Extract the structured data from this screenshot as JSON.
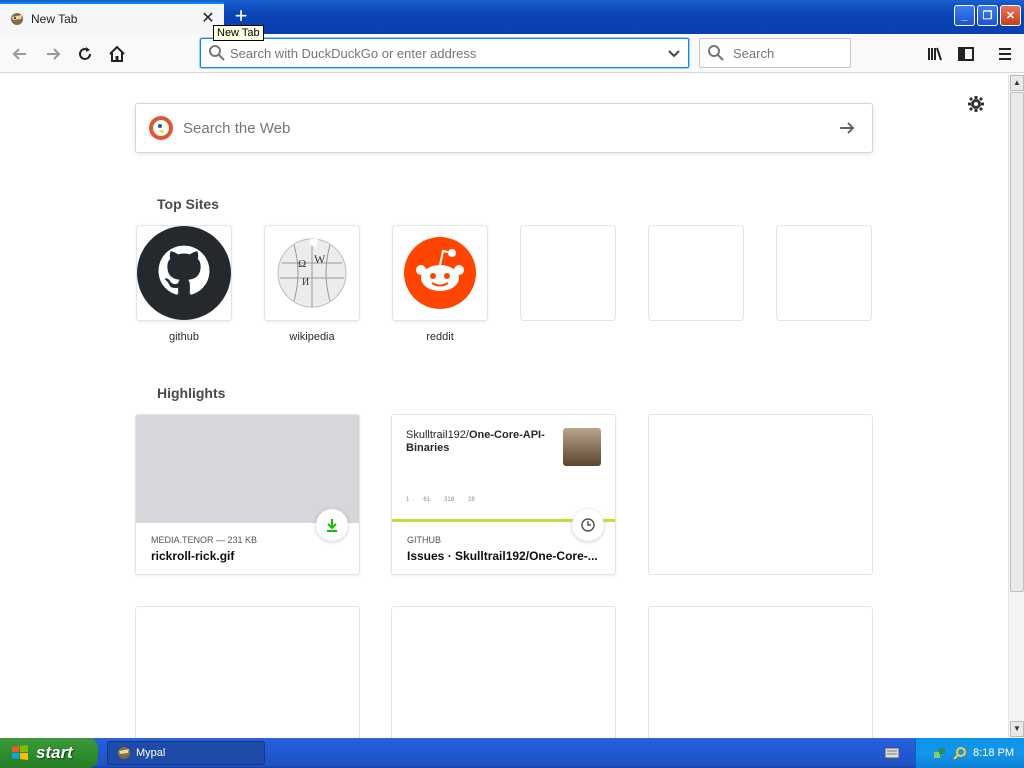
{
  "window": {
    "tab_title": "New Tab",
    "tooltip": "New Tab"
  },
  "navbar": {
    "url_placeholder": "Search with DuckDuckGo or enter address",
    "search_placeholder": "Search"
  },
  "content": {
    "web_search_placeholder": "Search the Web",
    "top_sites_title": "Top Sites",
    "top_sites": [
      {
        "label": "github",
        "icon": "github-icon"
      },
      {
        "label": "wikipedia",
        "icon": "wikipedia-icon"
      },
      {
        "label": "reddit",
        "icon": "reddit-icon"
      }
    ],
    "highlights_title": "Highlights",
    "highlights": [
      {
        "context": "MEDIA.TENOR — 231 KB",
        "title": "rickroll-rick.gif",
        "badge": "download-icon"
      },
      {
        "context": "GITHUB",
        "title": "Issues · Skulltrail192/One-Core-...",
        "badge": "clock-icon",
        "preview_user": "Skulltrail192/",
        "preview_repo": "One-Core-API-Binaries",
        "stats": [
          "1",
          "61",
          "318",
          "28"
        ]
      }
    ]
  },
  "taskbar": {
    "start_label": "start",
    "task_label": "Mypal",
    "clock": "8:18 PM"
  },
  "colors": {
    "accent": "#0a84ff",
    "reddit": "#ff4500",
    "github": "#24292e",
    "download": "#12bc00"
  }
}
